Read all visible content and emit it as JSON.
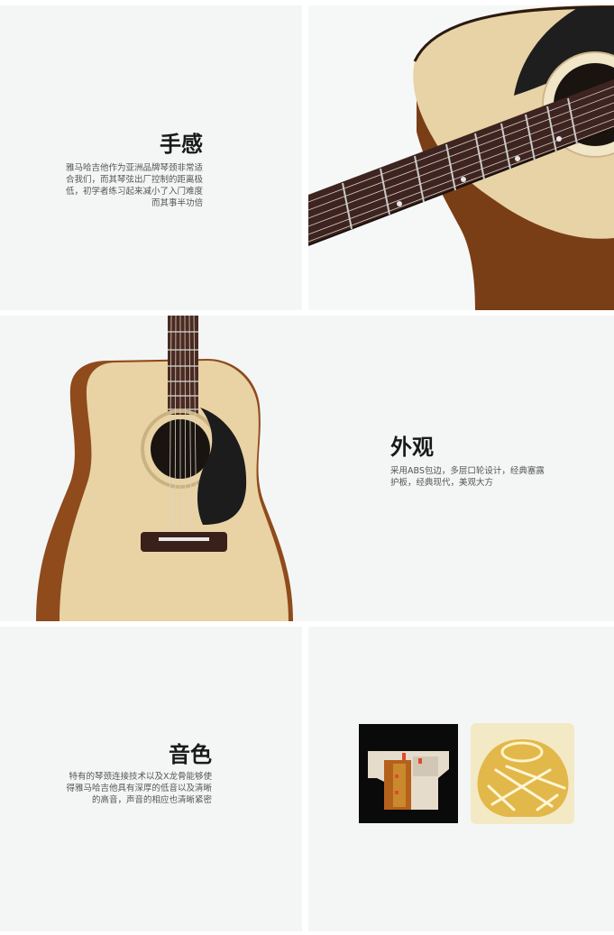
{
  "sections": {
    "feel": {
      "title": "手感",
      "lines": [
        "雅马哈吉他作为亚洲品牌琴颈非常适",
        "合我们，而其琴弦出厂控制的距离极",
        "低，初学者练习起来减小了入门难度",
        "而其事半功倍"
      ]
    },
    "appearance": {
      "title": "外观",
      "lines": [
        "采用ABS包边，多层口轮设计，经典塞露",
        "护板，经典现代，美观大方"
      ]
    },
    "tone": {
      "title": "音色",
      "lines": [
        "特有的琴颈连接技术以及X龙骨能够使",
        "得雅马哈吉他具有深厚的低音以及清晰",
        "的高音，声音的相应也清晰紧密"
      ]
    }
  },
  "colors": {
    "panel_bg": "#f4f6f6",
    "spruce": "#e6cfa0",
    "mahogany": "#8a4a1f",
    "rosewood": "#4a2a22",
    "pickguard": "#1c1c1c",
    "gold": "#e2b84a"
  }
}
